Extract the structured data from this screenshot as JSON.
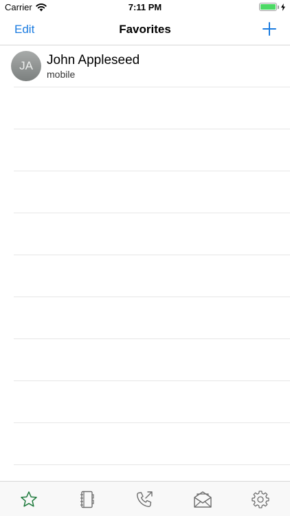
{
  "status_bar": {
    "carrier": "Carrier",
    "time": "7:11 PM",
    "battery_level": 1.0
  },
  "nav": {
    "edit_label": "Edit",
    "title": "Favorites",
    "add_icon": "plus-icon"
  },
  "favorites": [
    {
      "initials": "JA",
      "name": "John Appleseed",
      "label": "mobile"
    }
  ],
  "empty_rows": 9,
  "tabs": [
    {
      "name": "favorites",
      "icon": "star-icon",
      "selected": true
    },
    {
      "name": "contacts",
      "icon": "address-book-icon",
      "selected": false
    },
    {
      "name": "recents",
      "icon": "phone-outgoing-icon",
      "selected": false
    },
    {
      "name": "voicemail",
      "icon": "envelope-open-icon",
      "selected": false
    },
    {
      "name": "settings",
      "icon": "gear-icon",
      "selected": false
    }
  ],
  "colors": {
    "accent": "#1a7be0",
    "selected_tab": "#1e7a3c",
    "tab_icon": "#6d6d6d"
  }
}
